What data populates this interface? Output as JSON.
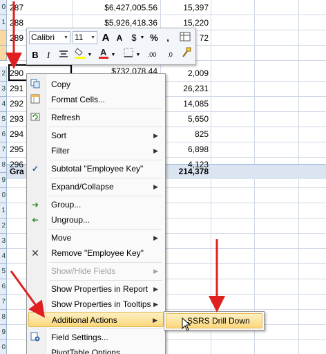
{
  "rows": [
    {
      "num": "287",
      "amount": "$6,427,005.56",
      "count": "15,397"
    },
    {
      "num": "288",
      "amount": "$5,926,418.36",
      "count": "15,220"
    },
    {
      "num": "289",
      "amount": "",
      "count": "72"
    },
    {
      "num": "290",
      "amount": "$732,078.44",
      "count": "2,009"
    },
    {
      "num": "291",
      "amount": "",
      "count": "26,231"
    },
    {
      "num": "292",
      "amount": "",
      "count": "14,085"
    },
    {
      "num": "293",
      "amount": "",
      "count": "5,650"
    },
    {
      "num": "294",
      "amount": "",
      "count": "825"
    },
    {
      "num": "295",
      "amount": "",
      "count": "6,898"
    },
    {
      "num": "296",
      "amount": "",
      "count": "4,123"
    },
    {
      "num": "Gra",
      "amount": "",
      "count": "214,378"
    }
  ],
  "row_headers": [
    "0",
    "1",
    "",
    "",
    "2",
    "3",
    "4",
    "5",
    "6",
    "7",
    "8",
    "9",
    "0",
    "1",
    "2",
    "3",
    "4",
    "5",
    "6",
    "7",
    "8",
    "9",
    "0",
    "1"
  ],
  "toolbar": {
    "font_name": "Calibri",
    "font_size": "11",
    "grow_font": "A",
    "shrink_font": "A",
    "currency": "$",
    "percent": "%",
    "comma": ",",
    "bold": "B",
    "italic": "I",
    "inc_decimal": ".00",
    "dec_decimal": ".0"
  },
  "menu": {
    "items": [
      {
        "label": "Copy",
        "icon": "copy-icon",
        "submenu": false,
        "disabled": false
      },
      {
        "label": "Format Cells...",
        "icon": "format-cells-icon",
        "submenu": false,
        "disabled": false
      },
      {
        "label": "Refresh",
        "icon": "refresh-icon",
        "submenu": false,
        "disabled": false
      },
      {
        "label": "Sort",
        "icon": "",
        "submenu": true,
        "disabled": false
      },
      {
        "label": "Filter",
        "icon": "",
        "submenu": true,
        "disabled": false
      },
      {
        "label": "Subtotal \"Employee Key\"",
        "icon": "check-icon",
        "submenu": false,
        "disabled": false
      },
      {
        "label": "Expand/Collapse",
        "icon": "",
        "submenu": true,
        "disabled": false
      },
      {
        "label": "Group...",
        "icon": "group-icon",
        "submenu": false,
        "disabled": false
      },
      {
        "label": "Ungroup...",
        "icon": "ungroup-icon",
        "submenu": false,
        "disabled": false
      },
      {
        "label": "Move",
        "icon": "",
        "submenu": true,
        "disabled": false
      },
      {
        "label": "Remove \"Employee Key\"",
        "icon": "remove-icon",
        "submenu": false,
        "disabled": false
      },
      {
        "label": "Show/Hide Fields",
        "icon": "",
        "submenu": true,
        "disabled": true
      },
      {
        "label": "Show Properties in Report",
        "icon": "",
        "submenu": true,
        "disabled": false
      },
      {
        "label": "Show Properties in Tooltips",
        "icon": "",
        "submenu": true,
        "disabled": false
      },
      {
        "label": "Additional Actions",
        "icon": "",
        "submenu": true,
        "disabled": false
      },
      {
        "label": "Field Settings...",
        "icon": "field-settings-icon",
        "submenu": false,
        "disabled": false
      },
      {
        "label": "PivotTable Options...",
        "icon": "",
        "submenu": false,
        "disabled": false
      }
    ]
  },
  "submenu": {
    "label": "SSRS Drill Down"
  },
  "colors": {
    "highlight": "#fbd77b",
    "arrow": "#e02020",
    "row_header": "#e4ecf7"
  }
}
